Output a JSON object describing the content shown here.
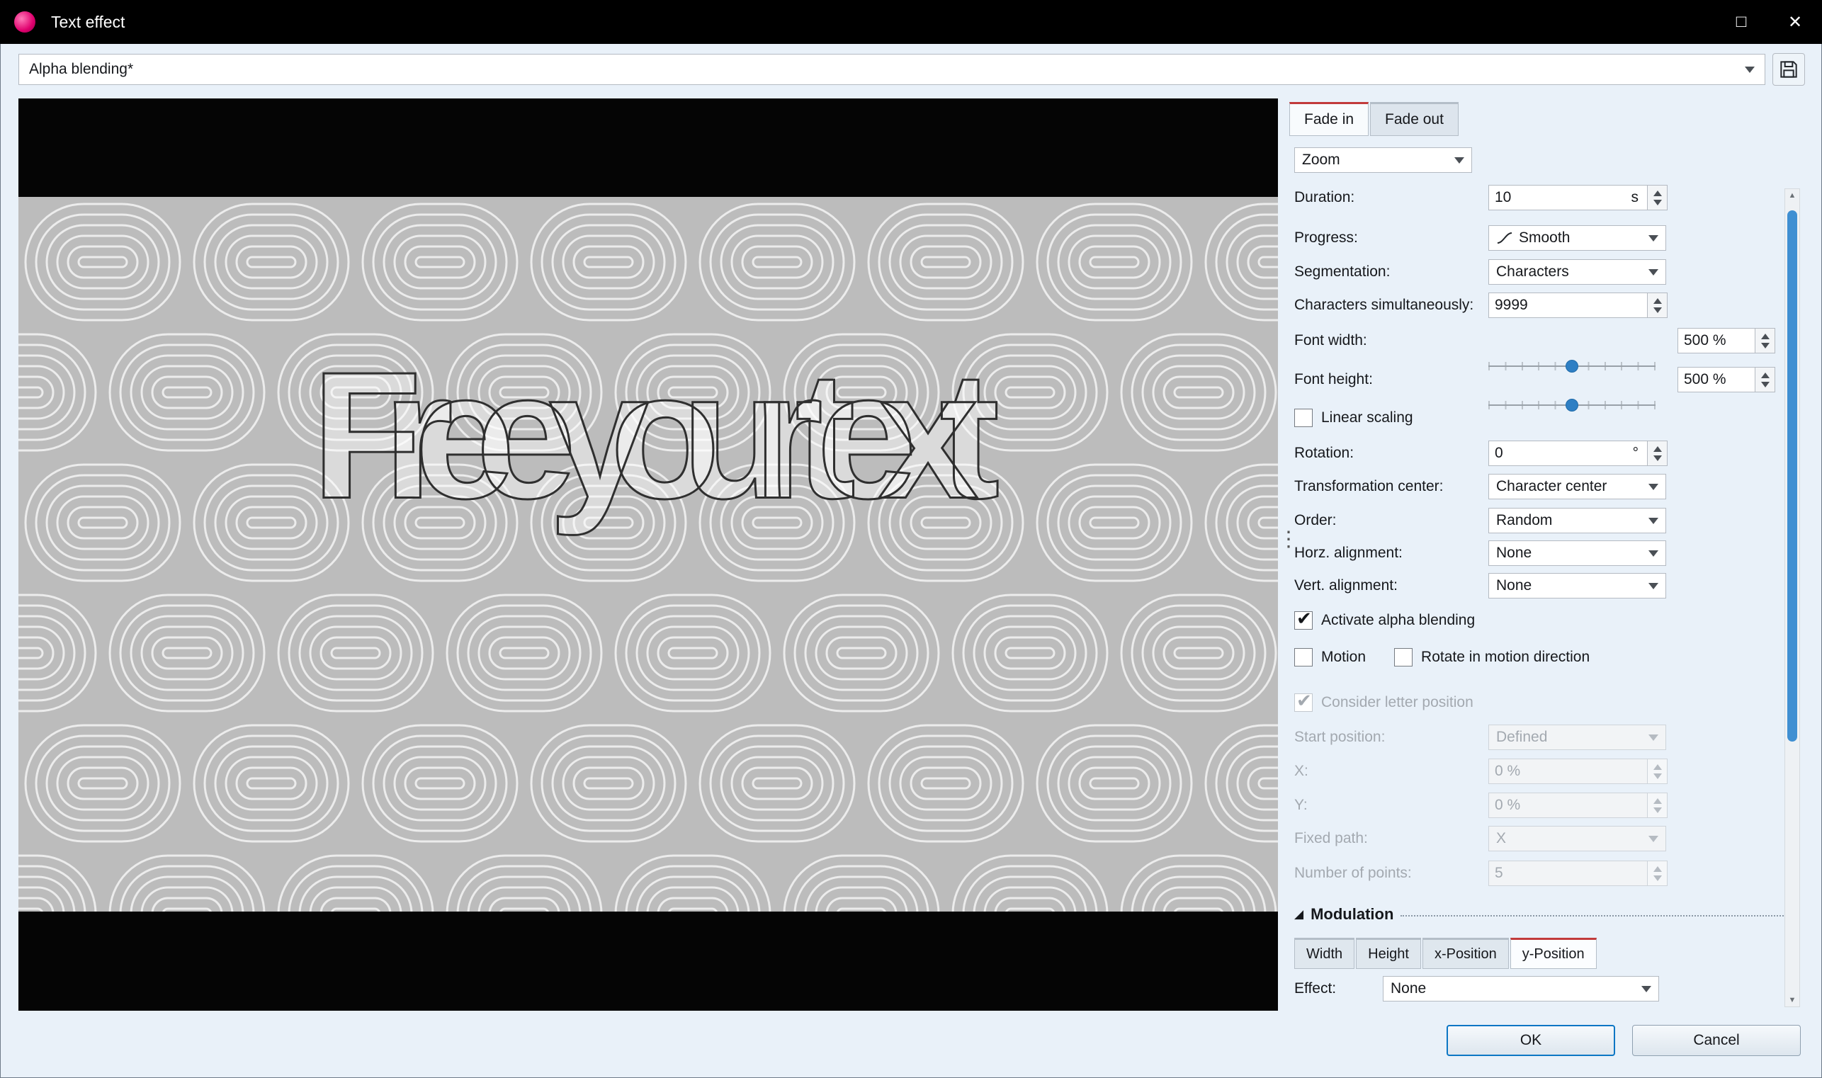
{
  "window": {
    "title": "Text effect",
    "maximize_glyph": "□",
    "close_glyph": "✕"
  },
  "preset": {
    "value": "Alpha blending*"
  },
  "preview": {
    "overlay_text": "Free your text"
  },
  "panel": {
    "tabs": {
      "fade_in": "Fade in",
      "fade_out": "Fade out"
    },
    "effect_type": "Zoom",
    "duration": {
      "label": "Duration:",
      "value": "10",
      "unit": "s"
    },
    "progress": {
      "label": "Progress:",
      "value": "Smooth"
    },
    "segmentation": {
      "label": "Segmentation:",
      "value": "Characters"
    },
    "chars_simultaneously": {
      "label": "Characters simultaneously:",
      "value": "9999"
    },
    "font_width": {
      "label": "Font width:",
      "value": "500 %"
    },
    "font_height": {
      "label": "Font height:",
      "value": "500 %"
    },
    "linear_scaling": {
      "label": "Linear scaling"
    },
    "rotation": {
      "label": "Rotation:",
      "value": "0",
      "unit": "°"
    },
    "transformation_center": {
      "label": "Transformation center:",
      "value": "Character center"
    },
    "order": {
      "label": "Order:",
      "value": "Random"
    },
    "horz_alignment": {
      "label": "Horz. alignment:",
      "value": "None"
    },
    "vert_alignment": {
      "label": "Vert. alignment:",
      "value": "None"
    },
    "activate_alpha_blending": {
      "label": "Activate alpha blending"
    },
    "motion": {
      "label": "Motion"
    },
    "rotate_in_motion_direction": {
      "label": "Rotate in motion direction"
    },
    "consider_letter_position": {
      "label": "Consider letter position"
    },
    "start_position": {
      "label": "Start position:",
      "value": "Defined"
    },
    "x": {
      "label": "X:",
      "value": "0 %"
    },
    "y": {
      "label": "Y:",
      "value": "0 %"
    },
    "fixed_path": {
      "label": "Fixed path:",
      "value": "X"
    },
    "number_of_points": {
      "label": "Number of points:",
      "value": "5"
    }
  },
  "modulation": {
    "header": "Modulation",
    "tabs": [
      "Width",
      "Height",
      "x-Position",
      "y-Position"
    ],
    "active_tab": "y-Position",
    "effect": {
      "label": "Effect:",
      "value": "None"
    }
  },
  "footer": {
    "ok": "OK",
    "cancel": "Cancel"
  },
  "icons": {
    "check": "✔",
    "dots": "⋮",
    "section_triangle": "◢",
    "scroll_up": "▲",
    "scroll_down": "▼"
  },
  "colors": {
    "accent_red": "#c23b3b",
    "slider_blue": "#2e7fc4",
    "scrollbar_blue": "#3f8fd2",
    "titlebar": "#000000"
  }
}
